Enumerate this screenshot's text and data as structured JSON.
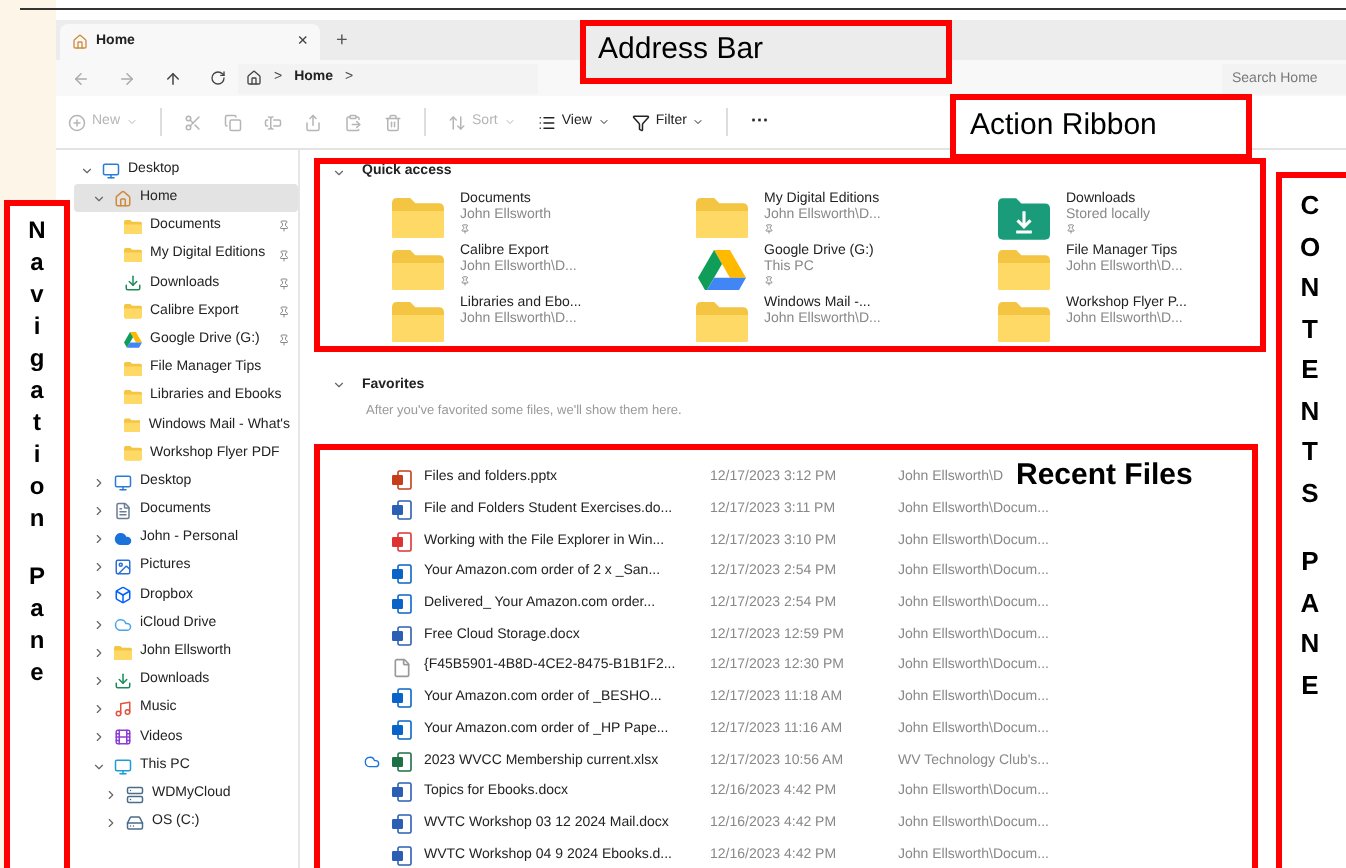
{
  "tab": {
    "title": "Home",
    "close": "×",
    "new_tab": "+"
  },
  "address": {
    "crumbs": [
      "Home"
    ],
    "separator": ">",
    "search": {
      "placeholder": "Search Home"
    }
  },
  "ribbon": [
    {
      "kind": "new",
      "label": "New",
      "disabled": true
    },
    {
      "kind": "cut",
      "disabled": true
    },
    {
      "kind": "copy",
      "disabled": true
    },
    {
      "kind": "rename",
      "disabled": true
    },
    {
      "kind": "share",
      "disabled": true
    },
    {
      "kind": "paste",
      "disabled": true
    },
    {
      "kind": "delete",
      "disabled": true
    },
    {
      "kind": "sort",
      "label": "Sort",
      "disabled": true
    },
    {
      "kind": "view",
      "label": "View",
      "disabled": false
    },
    {
      "kind": "filter",
      "label": "Filter",
      "disabled": false
    },
    {
      "kind": "more",
      "label": "···",
      "disabled": false
    }
  ],
  "sidebar": {
    "items": [
      {
        "label": "Desktop",
        "kind": "desktop",
        "expanded": true,
        "selected": false,
        "children": [
          {
            "label": "Home",
            "kind": "home",
            "expanded": true,
            "selected": true,
            "children": [
              {
                "label": "Documents",
                "kind": "folder",
                "pinned": true,
                "selected": false
              },
              {
                "label": "My Digital Editions",
                "kind": "folder",
                "pinned": true,
                "selected": false
              },
              {
                "label": "Downloads",
                "kind": "download",
                "pinned": true,
                "selected": false
              },
              {
                "label": "Calibre Export",
                "kind": "folder",
                "pinned": true,
                "selected": false
              },
              {
                "label": "Google Drive (G:)",
                "kind": "drive",
                "pinned": true,
                "selected": false
              },
              {
                "label": "File Manager Tips",
                "kind": "folder",
                "pinned": false,
                "selected": false
              },
              {
                "label": "Libraries and Ebooks",
                "kind": "folder",
                "pinned": false,
                "selected": false
              },
              {
                "label": "Windows Mail - What's",
                "kind": "folder",
                "pinned": false,
                "selected": false
              },
              {
                "label": "Workshop Flyer PDF",
                "kind": "folder",
                "pinned": false,
                "selected": false
              }
            ]
          },
          {
            "label": "Desktop",
            "kind": "desktop",
            "expanded": false,
            "selected": false
          },
          {
            "label": "Documents",
            "kind": "documents",
            "expanded": false,
            "selected": false
          },
          {
            "label": "John - Personal",
            "kind": "cloud",
            "expanded": false,
            "selected": false
          },
          {
            "label": "Pictures",
            "kind": "pictures",
            "expanded": false,
            "selected": false
          },
          {
            "label": "Dropbox",
            "kind": "dropbox",
            "expanded": false,
            "selected": false
          },
          {
            "label": "iCloud Drive",
            "kind": "icloud",
            "expanded": false,
            "selected": false
          },
          {
            "label": "John Ellsworth",
            "kind": "folder",
            "expanded": false,
            "selected": false
          },
          {
            "label": "Downloads",
            "kind": "download",
            "expanded": false,
            "selected": false
          },
          {
            "label": "Music",
            "kind": "music",
            "expanded": false,
            "selected": false
          },
          {
            "label": "Videos",
            "kind": "videos",
            "expanded": false,
            "selected": false
          },
          {
            "label": "This PC",
            "kind": "pc",
            "expanded": true,
            "selected": false,
            "children": [
              {
                "label": "WDMyCloud",
                "kind": "network",
                "expanded": false,
                "selected": false
              },
              {
                "label": "OS (C:)",
                "kind": "disk",
                "expanded": false,
                "selected": false
              }
            ]
          }
        ]
      }
    ]
  },
  "quick_access": {
    "title": "Quick access",
    "expanded": true,
    "items": [
      {
        "name": "Documents",
        "detail": "John Ellsworth",
        "kind": "folder",
        "pinned": true
      },
      {
        "name": "My Digital Editions",
        "detail": "John Ellsworth\\D...",
        "kind": "folder",
        "pinned": true
      },
      {
        "name": "Downloads",
        "detail": "Stored locally",
        "kind": "download",
        "pinned": true
      },
      {
        "name": "Calibre Export",
        "detail": "John Ellsworth\\D...",
        "kind": "folder",
        "pinned": true
      },
      {
        "name": "Google Drive (G:)",
        "detail": "This PC",
        "kind": "drive",
        "pinned": true
      },
      {
        "name": "File Manager Tips",
        "detail": "John Ellsworth\\D...",
        "kind": "folder",
        "pinned": false
      },
      {
        "name": "Libraries and Ebo...",
        "detail": "John Ellsworth\\D...",
        "kind": "folder",
        "pinned": false
      },
      {
        "name": "Windows Mail -...",
        "detail": "John Ellsworth\\D...",
        "kind": "folder",
        "pinned": false
      },
      {
        "name": "Workshop Flyer P...",
        "detail": "John Ellsworth\\D...",
        "kind": "folder",
        "pinned": false
      }
    ]
  },
  "favorites": {
    "title": "Favorites",
    "expanded": true,
    "message": "After you've favorited some files, we'll show them here."
  },
  "recent": {
    "rows": [
      {
        "name": "Files and folders.pptx",
        "date": "12/17/2023 3:12 PM",
        "location": "John Ellsworth\\D",
        "kind": "pptx",
        "cloud": false
      },
      {
        "name": "File and Folders Student Exercises.do...",
        "date": "12/17/2023 3:11 PM",
        "location": "John Ellsworth\\Docum...",
        "kind": "docx",
        "cloud": false
      },
      {
        "name": "Working with the File Explorer in Win...",
        "date": "12/17/2023 3:10 PM",
        "location": "John Ellsworth\\Docum...",
        "kind": "pdf",
        "cloud": false
      },
      {
        "name": "Your Amazon.com order of 2 x _San...",
        "date": "12/17/2023 2:54 PM",
        "location": "John Ellsworth\\Docum...",
        "kind": "mail",
        "cloud": false
      },
      {
        "name": "Delivered_ Your Amazon.com order...",
        "date": "12/17/2023 2:54 PM",
        "location": "John Ellsworth\\Docum...",
        "kind": "mail",
        "cloud": false
      },
      {
        "name": "Free Cloud Storage.docx",
        "date": "12/17/2023 12:59 PM",
        "location": "John Ellsworth\\Docum...",
        "kind": "docx",
        "cloud": false
      },
      {
        "name": "{F45B5901-4B8D-4CE2-8475-B1B1F2...",
        "date": "12/17/2023 12:30 PM",
        "location": "John Ellsworth\\Docum...",
        "kind": "file",
        "cloud": false
      },
      {
        "name": "Your Amazon.com order of _BESHO...",
        "date": "12/17/2023 11:18 AM",
        "location": "John Ellsworth\\Docum...",
        "kind": "mail",
        "cloud": false
      },
      {
        "name": "Your Amazon.com order of _HP Pape...",
        "date": "12/17/2023 11:16 AM",
        "location": "John Ellsworth\\Docum...",
        "kind": "mail",
        "cloud": false
      },
      {
        "name": "2023 WVCC Membership current.xlsx",
        "date": "12/17/2023 10:56 AM",
        "location": "WV Technology Club's...",
        "kind": "xlsx",
        "cloud": true
      },
      {
        "name": "Topics for Ebooks.docx",
        "date": "12/16/2023 4:42 PM",
        "location": "John Ellsworth\\Docum...",
        "kind": "docx",
        "cloud": false
      },
      {
        "name": "WVTC Workshop 03 12 2024 Mail.docx",
        "date": "12/16/2023 4:42 PM",
        "location": "John Ellsworth\\Docum...",
        "kind": "docx",
        "cloud": false
      },
      {
        "name": "WVTC Workshop 04 9 2024 Ebooks.d...",
        "date": "12/16/2023 4:42 PM",
        "location": "John Ellsworth\\Docum...",
        "kind": "docx",
        "cloud": false
      }
    ]
  },
  "annotations": {
    "address_bar": "Address Bar",
    "action_ribbon": "Action Ribbon",
    "recent_files": "Recent Files",
    "navigation_pane": "Navigation Pane",
    "contents_pane": "CONTENTS PANE"
  }
}
